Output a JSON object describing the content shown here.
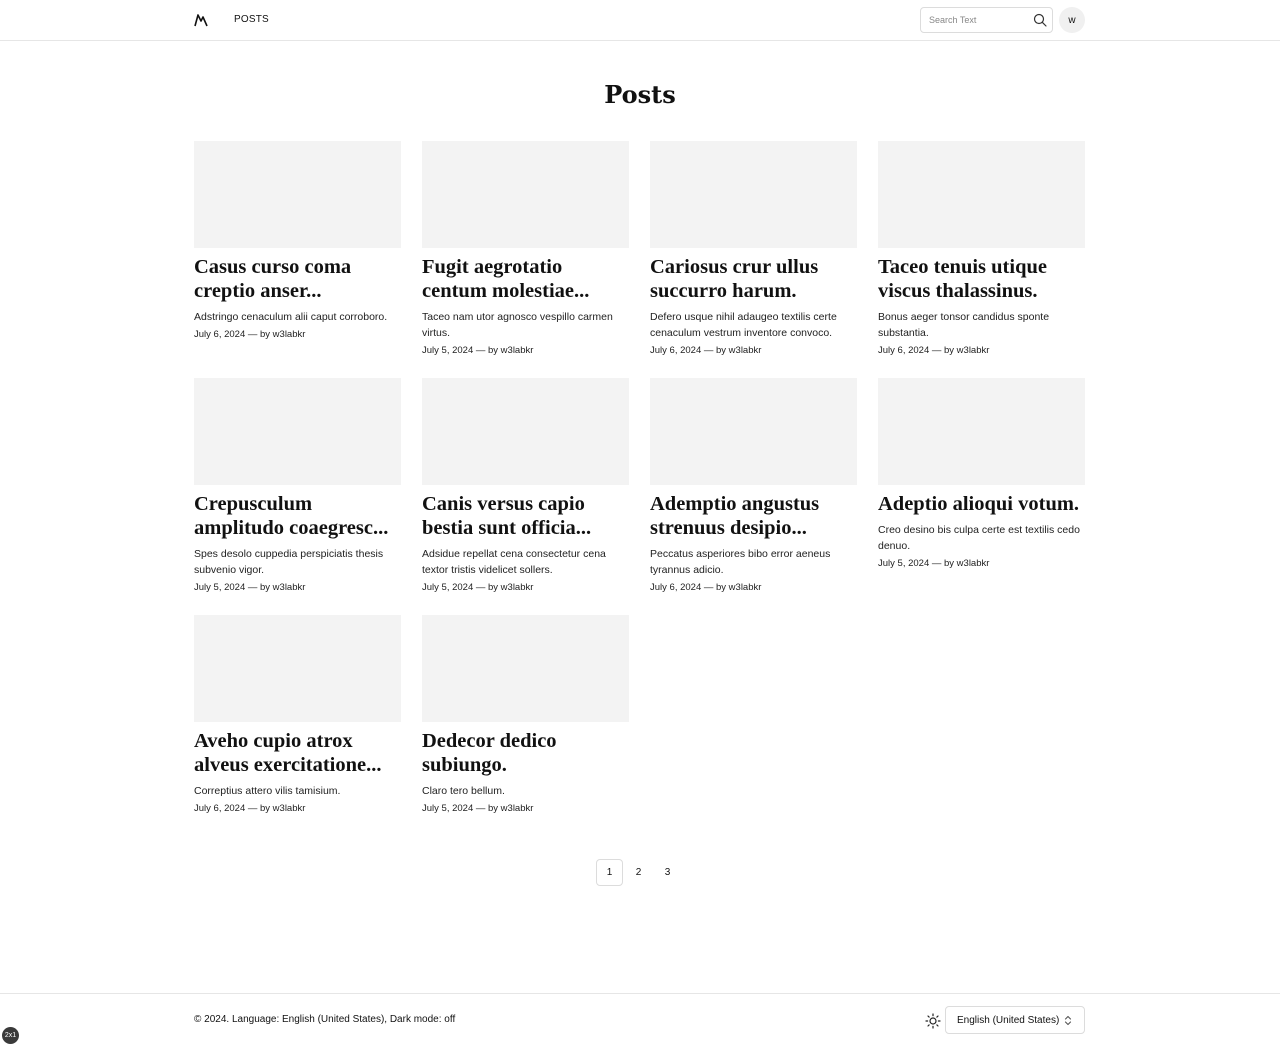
{
  "header": {
    "logo_icon": "mountain-logo-icon",
    "nav": [
      {
        "label": "POSTS"
      }
    ],
    "search": {
      "placeholder": "Search Text",
      "value": "",
      "icon": "search-icon"
    },
    "avatar_initial": "w"
  },
  "page": {
    "title": "Posts"
  },
  "posts": [
    {
      "title": "Casus curso coma creptio anser...",
      "excerpt": "Adstringo cenaculum alii caput corroboro.",
      "meta": "July 6, 2024 — by w3labkr"
    },
    {
      "title": "Fugit aegrotatio centum molestiae...",
      "excerpt": "Taceo nam utor agnosco vespillo carmen virtus.",
      "meta": "July 5, 2024 — by w3labkr"
    },
    {
      "title": "Cariosus crur ullus succurro harum.",
      "excerpt": "Defero usque nihil adaugeo textilis certe cenaculum vestrum inventore convoco.",
      "meta": "July 6, 2024 — by w3labkr"
    },
    {
      "title": "Taceo tenuis utique viscus thalassinus.",
      "excerpt": "Bonus aeger tonsor candidus sponte substantia.",
      "meta": "July 6, 2024 — by w3labkr"
    },
    {
      "title": "Crepusculum amplitudo coaegresc...",
      "excerpt": "Spes desolo cuppedia perspiciatis thesis subvenio vigor.",
      "meta": "July 5, 2024 — by w3labkr"
    },
    {
      "title": "Canis versus capio bestia sunt officia...",
      "excerpt": "Adsidue repellat cena consectetur cena textor tristis videlicet sollers.",
      "meta": "July 5, 2024 — by w3labkr"
    },
    {
      "title": "Ademptio angustus strenuus desipio...",
      "excerpt": "Peccatus asperiores bibo error aeneus tyrannus adicio.",
      "meta": "July 6, 2024 — by w3labkr"
    },
    {
      "title": "Adeptio alioqui votum.",
      "excerpt": "Creo desino bis culpa certe est textilis cedo denuo.",
      "meta": "July 5, 2024 — by w3labkr"
    },
    {
      "title": "Aveho cupio atrox alveus exercitatione...",
      "excerpt": "Correptius attero vilis tamisium.",
      "meta": "July 6, 2024 — by w3labkr"
    },
    {
      "title": "Dedecor dedico subiungo.",
      "excerpt": "Claro tero bellum.",
      "meta": "July 5, 2024 — by w3labkr"
    }
  ],
  "pagination": {
    "pages": [
      "1",
      "2",
      "3"
    ],
    "current": "1"
  },
  "footer": {
    "copyright": "© 2024. Language: English (United States), Dark mode: off",
    "theme_icon": "sun-icon",
    "language_select": {
      "value": "English (United States)",
      "icon": "chevron-up-down-icon"
    }
  },
  "overlay_badge": "2x1",
  "colors": {
    "thumb_bg": "#f3f3f3",
    "border": "#e6e6e6",
    "text": "#111111"
  }
}
